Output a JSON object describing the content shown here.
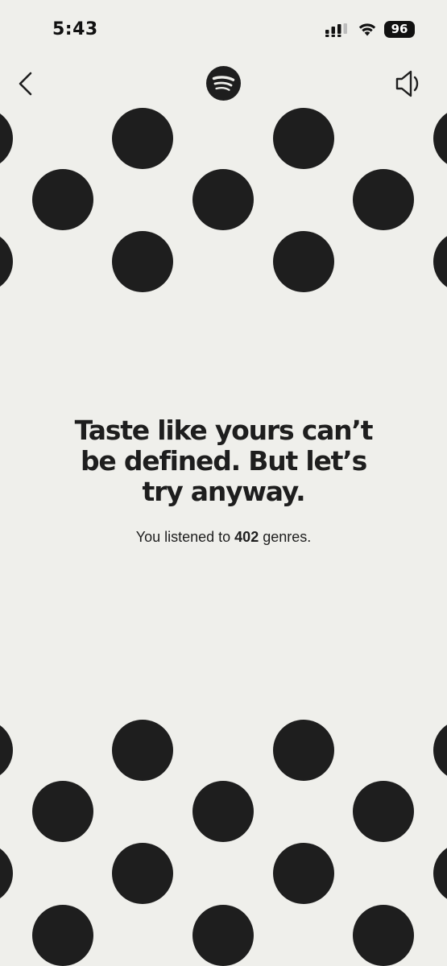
{
  "status_bar": {
    "time": "5:43",
    "battery": "96",
    "icons": [
      "signal-icon",
      "wifi-icon",
      "battery-icon"
    ]
  },
  "header": {
    "back_icon": "chevron-left-icon",
    "logo_icon": "spotify-logo-icon",
    "sound_icon": "speaker-icon"
  },
  "main": {
    "headline": {
      "line1": "Taste like yours can’t",
      "line2": "be defined. But let’s",
      "line3": "try anyway."
    },
    "subtitle": {
      "prefix": "You listened to ",
      "count": "402",
      "suffix": " genres."
    }
  },
  "colors": {
    "background": "#efefeb",
    "dots": "#1e1e1e",
    "text": "#1e1e1e"
  }
}
